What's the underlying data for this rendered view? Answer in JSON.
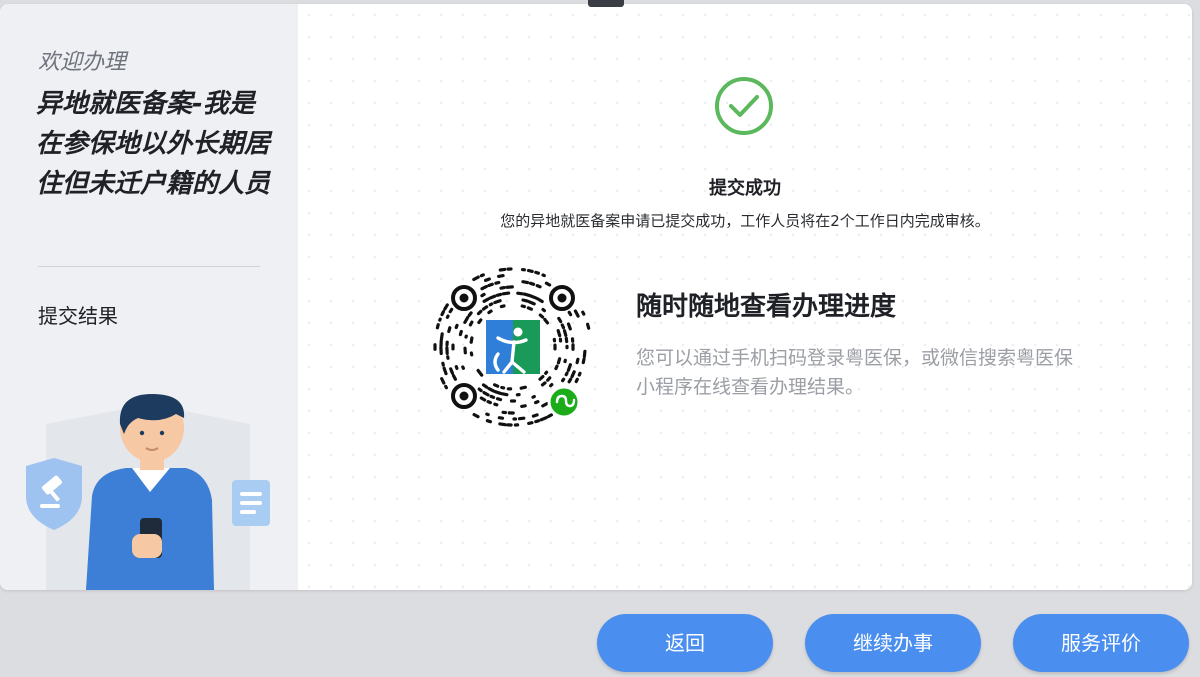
{
  "sidebar": {
    "welcome": "欢迎办理",
    "service_title": "异地就医备案-我是在参保地以外长期居住但未迁户籍的人员",
    "step_label": "提交结果"
  },
  "result": {
    "title": "提交成功",
    "description": "您的异地就医备案申请已提交成功，工作人员将在2个工作日内完成审核。"
  },
  "progress": {
    "title": "随时随地查看办理进度",
    "description": "您可以通过手机扫码登录粤医保，或微信搜索粤医保小程序在线查看办理结果。"
  },
  "buttons": {
    "back": "返回",
    "continue": "继续办事",
    "rate": "服务评价"
  },
  "colors": {
    "accent": "#4a8ff0",
    "success": "#5cb85c",
    "sidebar_bg": "#eef0f4"
  },
  "icons": {
    "success": "check-circle-icon",
    "qr": "mini-program-qr-code",
    "shield": "shield-gavel-icon",
    "document": "document-icon"
  }
}
